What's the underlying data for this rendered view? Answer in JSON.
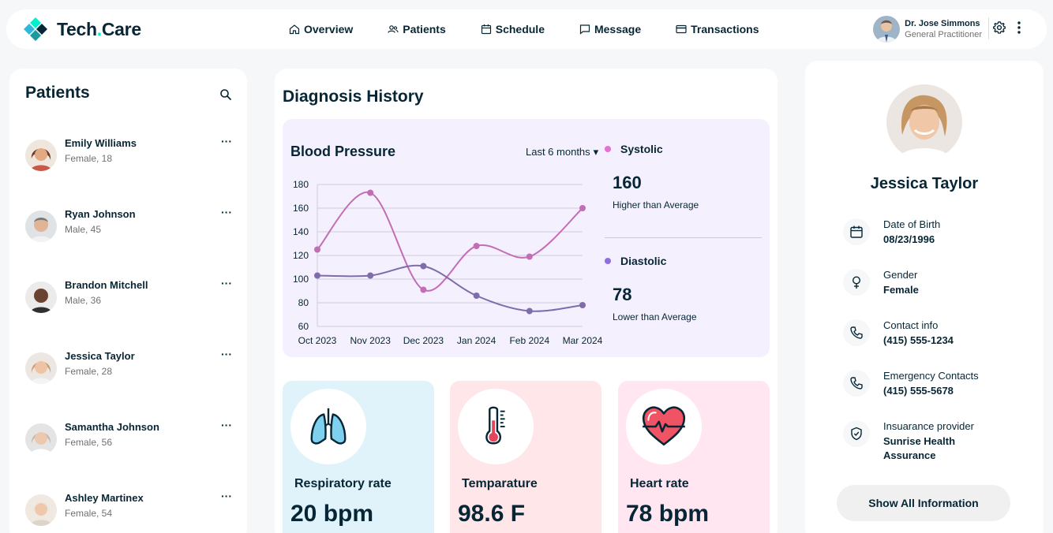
{
  "brand": {
    "name_part1": "Tech",
    "name_dot": ".",
    "name_part2": "Care"
  },
  "nav": [
    {
      "label": "Overview",
      "icon": "home-icon"
    },
    {
      "label": "Patients",
      "icon": "users-icon"
    },
    {
      "label": "Schedule",
      "icon": "calendar-icon"
    },
    {
      "label": "Message",
      "icon": "chat-icon"
    },
    {
      "label": "Transactions",
      "icon": "credit-card-icon"
    }
  ],
  "doctor": {
    "name": "Dr. Jose Simmons",
    "role": "General Practitioner"
  },
  "patients": {
    "title": "Patients",
    "items": [
      {
        "name": "Emily Williams",
        "info": "Female, 18"
      },
      {
        "name": "Ryan Johnson",
        "info": "Male, 45"
      },
      {
        "name": "Brandon Mitchell",
        "info": "Male, 36"
      },
      {
        "name": "Jessica Taylor",
        "info": "Female, 28"
      },
      {
        "name": "Samantha Johnson",
        "info": "Female, 56"
      },
      {
        "name": "Ashley Martinex",
        "info": "Female, 54"
      }
    ],
    "more_glyph": "···"
  },
  "diagnosis": {
    "title": "Diagnosis History",
    "bp_title": "Blood Pressure",
    "range": "Last 6 months",
    "range_caret": "▾",
    "systolic": {
      "label": "Systolic",
      "value": "160",
      "note": "Higher than Average",
      "color": "#c26eb4"
    },
    "diastolic": {
      "label": "Diastolic",
      "value": "78",
      "note": "Lower than Average",
      "color": "#7e6cab"
    }
  },
  "chart_data": {
    "type": "line",
    "categories": [
      "Oct 2023",
      "Nov 2023",
      "Dec 2023",
      "Jan 2024",
      "Feb 2024",
      "Mar 2024"
    ],
    "series": [
      {
        "name": "Systolic",
        "values": [
          125,
          173,
          91,
          128,
          119,
          160
        ],
        "color": "#e66fd2"
      },
      {
        "name": "Diastolic",
        "values": [
          103,
          103,
          111,
          86,
          73,
          78
        ],
        "color": "#8c6fe6"
      }
    ],
    "y_ticks": [
      60,
      80,
      100,
      120,
      140,
      160,
      180
    ],
    "ylim": [
      60,
      180
    ],
    "grid": true,
    "legend": "right"
  },
  "vitals": [
    {
      "label": "Respiratory rate",
      "value": "20 bpm",
      "bg": "#e0f3fa",
      "icon": "lungs-icon"
    },
    {
      "label": "Temparature",
      "value": "98.6 F",
      "bg": "#ffe6e9",
      "icon": "thermometer-icon"
    },
    {
      "label": "Heart rate",
      "value": "78 bpm",
      "bg": "#ffe6f1",
      "icon": "heart-icon"
    }
  ],
  "profile": {
    "name": "Jessica Taylor",
    "rows": [
      {
        "label": "Date of Birth",
        "value": "08/23/1996",
        "icon": "calendar-icon"
      },
      {
        "label": "Gender",
        "value": "Female",
        "icon": "female-icon"
      },
      {
        "label": "Contact info",
        "value": "(415) 555-1234",
        "icon": "phone-icon"
      },
      {
        "label": "Emergency Contacts",
        "value": "(415) 555-5678",
        "icon": "phone-icon"
      },
      {
        "label": "Insuarance provider",
        "value": "Sunrise Health Assurance",
        "icon": "shield-icon"
      }
    ],
    "show_all": "Show All Information"
  }
}
